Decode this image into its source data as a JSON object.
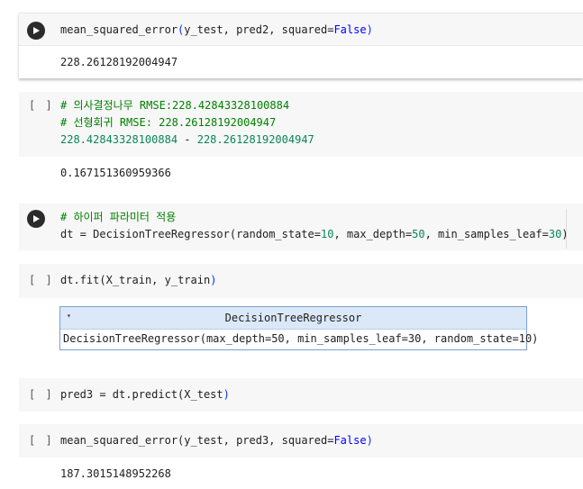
{
  "cells": [
    {
      "id": "c1",
      "state": "run",
      "code": [
        [
          {
            "t": "mean_squared_error",
            "c": ""
          },
          {
            "t": "(",
            "c": "paren"
          },
          {
            "t": "y_test, pred2, squared=",
            "c": ""
          },
          {
            "t": "False",
            "c": "kw"
          },
          {
            "t": ")",
            "c": "paren"
          }
        ]
      ],
      "output": "228.26128192004947"
    },
    {
      "id": "c2",
      "state": "idle",
      "bracket": "[ ]",
      "code": [
        [
          {
            "t": "# 의사결정나무 RMSE:228.42843328100884",
            "c": "cmt"
          }
        ],
        [
          {
            "t": "# 선형회귀 RMSE: 228.26128192004947",
            "c": "cmt"
          }
        ],
        [
          {
            "t": "228.42843328100884",
            "c": "num"
          },
          {
            "t": " - ",
            "c": ""
          },
          {
            "t": "228.26128192004947",
            "c": "num"
          }
        ]
      ],
      "output": "0.167151360959366"
    },
    {
      "id": "c3",
      "state": "run",
      "code": [
        [
          {
            "t": "# 하이퍼 파라미터 적용",
            "c": "cmt"
          }
        ],
        [
          {
            "t": "dt = DecisionTreeRegressor(random_state=",
            "c": ""
          },
          {
            "t": "10",
            "c": "num"
          },
          {
            "t": ", max_depth=",
            "c": ""
          },
          {
            "t": "50",
            "c": "num"
          },
          {
            "t": ", min_samples_leaf=",
            "c": ""
          },
          {
            "t": "30",
            "c": "num"
          },
          {
            "t": ")",
            "c": ""
          }
        ]
      ]
    },
    {
      "id": "c4",
      "state": "idle",
      "bracket": "[ ]",
      "code": [
        [
          {
            "t": "dt.fit",
            "c": ""
          },
          {
            "t": "(",
            "c": ""
          },
          {
            "t": "X_train, y_train",
            "c": ""
          },
          {
            "t": ")",
            "c": "paren"
          }
        ]
      ],
      "estimator": {
        "title": "DecisionTreeRegressor",
        "repr": "DecisionTreeRegressor(max_depth=50, min_samples_leaf=30, random_state=10)",
        "arrow": "▾"
      }
    },
    {
      "id": "c5",
      "state": "idle",
      "bracket": "[ ]",
      "code": [
        [
          {
            "t": "pred3 = dt.predict",
            "c": ""
          },
          {
            "t": "(",
            "c": ""
          },
          {
            "t": "X_test",
            "c": ""
          },
          {
            "t": ")",
            "c": "paren"
          }
        ]
      ]
    },
    {
      "id": "c6",
      "state": "idle",
      "bracket": "[ ]",
      "code": [
        [
          {
            "t": "mean_squared_error",
            "c": ""
          },
          {
            "t": "(",
            "c": ""
          },
          {
            "t": "y_test, pred3, squared=",
            "c": ""
          },
          {
            "t": "False",
            "c": "kw"
          },
          {
            "t": ")",
            "c": "paren"
          }
        ]
      ],
      "output": "187.3015148952268"
    }
  ]
}
